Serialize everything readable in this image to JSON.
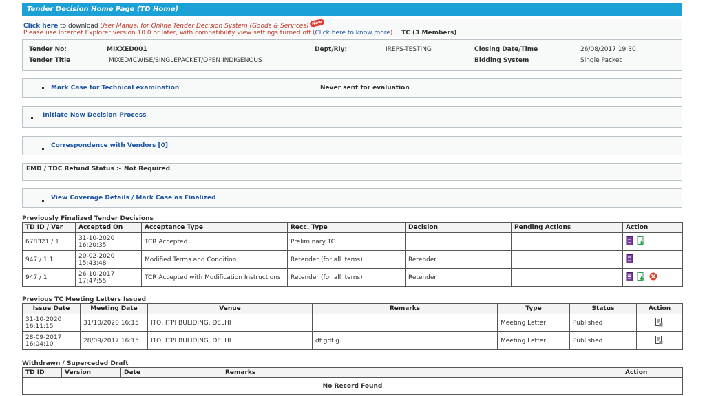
{
  "header": {
    "title": "Tender Decision Home Page (TD Home)"
  },
  "notice": {
    "click_here": "Click here",
    "download_text": " to download ",
    "manual_link": "User Manual for Online Tender Decision System (Goods & Services)",
    "new_badge": "New",
    "ie_text": "Please use Internet Explorer version 10.0 or later, with compatibility view settings turned off (",
    "know_more": "Click here to know more",
    "ie_close": ").",
    "tc_members": "TC (3 Members)"
  },
  "tender": {
    "no_label": "Tender No:",
    "no_value": "MIXXED001",
    "title_label": "Tender Title",
    "title_value": "MIXED/ICWISE/SINGLEPACKET/OPEN INDIGENOUS",
    "dept_label": "Dept/Rly:",
    "dept_value": "IREPS-TESTING",
    "closing_label": "Closing Date/Time",
    "closing_value": "26/08/2017 19:30",
    "bidding_label": "Bidding System",
    "bidding_value": "Single Packet"
  },
  "sections": {
    "technical_link": "Mark Case for Technical examination",
    "technical_status": "Never sent for evaluation",
    "initiate_link": "Initiate New Decision Process",
    "correspondence_link": "Correspondence with Vendors [0]",
    "emd_label": "EMD / TDC Refund Status  :-",
    "emd_value": "Not Required",
    "coverage_link": "View Coverage Details / Mark Case as Finalized"
  },
  "finalized": {
    "title": "Previously Finalized Tender Decisions",
    "headers": [
      "TD ID / Ver",
      "Accepted On",
      "Acceptance Type",
      "Recc. Type",
      "Decision",
      "Pending Actions",
      "Action"
    ],
    "rows": [
      {
        "id": "678321 / 1",
        "date": "31-10-2020",
        "time": "16:20:35",
        "acceptance": "TCR Accepted",
        "recc": "Preliminary TC",
        "decision": "",
        "pending": ""
      },
      {
        "id": "947 / 1.1",
        "date": "20-02-2020",
        "time": "15:43:48",
        "acceptance": "Modified Terms and Condition",
        "recc": "Retender (for all items)",
        "decision": "Retender",
        "pending": ""
      },
      {
        "id": "947 / 1",
        "date": "26-10-2017",
        "time": "17:47:55",
        "acceptance": "TCR Accepted with Modification Instructions",
        "recc": "Retender (for all items)",
        "decision": "Retender",
        "pending": ""
      }
    ]
  },
  "meetings": {
    "title": "Previous TC Meeting Letters Issued",
    "headers": [
      "Issue Date",
      "Meeting Date",
      "Venue",
      "Remarks",
      "Type",
      "Status",
      "Action"
    ],
    "rows": [
      {
        "issue_date": "31-10-2020",
        "issue_time": "16:11:15",
        "meeting_date": "31/10/2020 16:15",
        "venue": "ITO, ITPI BULIDING, DELHI",
        "remarks": "",
        "type": "Meeting Letter",
        "status": "Published"
      },
      {
        "issue_date": "28-09-2017",
        "issue_time": "16:04:10",
        "meeting_date": "28/09/2017 16:15",
        "venue": "ITO, ITPI BULIDING, DELHI",
        "remarks": "df gdf g",
        "type": "Meeting Letter",
        "status": "Published"
      }
    ]
  },
  "withdrawn": {
    "title": "Withdrawn / Superceded Draft",
    "headers": [
      "TD ID",
      "Version",
      "Date",
      "Remarks",
      "Action"
    ],
    "empty": "No Record Found"
  },
  "icons": {
    "document": "document-icon",
    "add": "add-document-icon",
    "delete": "delete-icon",
    "letter": "letter-icon"
  },
  "colors": {
    "header": "#1ba1d6",
    "link": "#1f55a4",
    "notice_red": "#c0392b",
    "icon_purple": "#7a3e9d",
    "icon_green": "#2e9e4f"
  }
}
